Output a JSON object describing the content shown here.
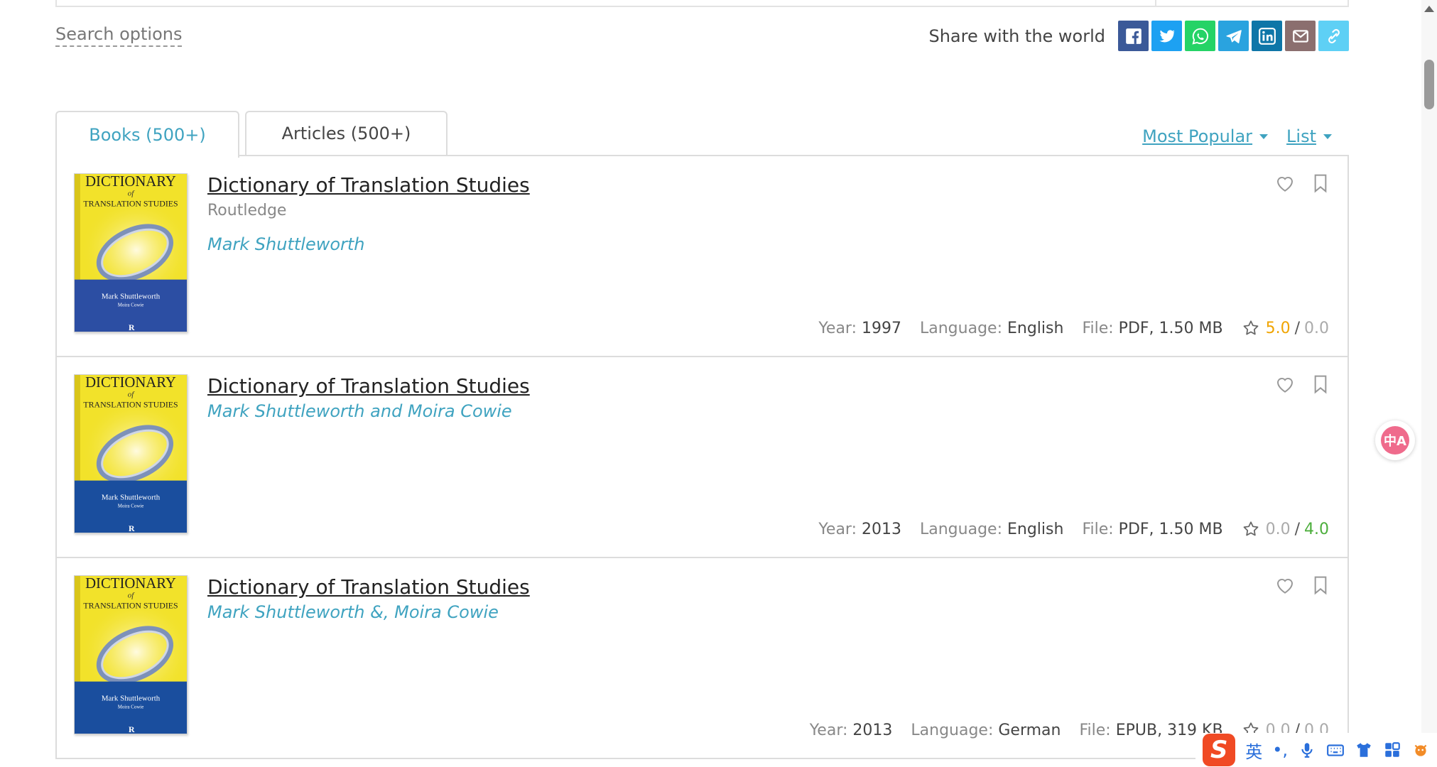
{
  "search_options_label": "Search options",
  "share": {
    "label": "Share with the world",
    "buttons": [
      {
        "name": "facebook",
        "color": "#3b5998"
      },
      {
        "name": "twitter",
        "color": "#1da1f2"
      },
      {
        "name": "whatsapp",
        "color": "#25d366"
      },
      {
        "name": "telegram",
        "color": "#2aa3df"
      },
      {
        "name": "linkedin",
        "color": "#0e76a8"
      },
      {
        "name": "email",
        "color": "#8b6f6f"
      },
      {
        "name": "copy-link",
        "color": "#5ed0f5"
      }
    ]
  },
  "tabs": [
    {
      "label": "Books (500+)",
      "active": true
    },
    {
      "label": "Articles  (500+)",
      "active": false
    }
  ],
  "sort": {
    "order_label": "Most Popular",
    "view_label": "List"
  },
  "books": [
    {
      "title": "Dictionary of Translation Studies",
      "publisher": "Routledge",
      "author": "Mark Shuttleworth",
      "year_label": "Year:",
      "year": "1997",
      "language_label": "Language:",
      "language": "English",
      "file_label": "File:",
      "file": "PDF, 1.50 MB",
      "rating_left": "5.0",
      "rating_sep": "/",
      "rating_right": "0.0",
      "rating_left_color": "gold",
      "rating_right_color": "gray",
      "cover": {
        "title_line1": "DICTIONARY",
        "title_of": "of",
        "title_line2": "TRANSLATION STUDIES",
        "author1": "Mark Shuttleworth",
        "author2": "Moira Cowie",
        "band_color": "#2c4ea3"
      }
    },
    {
      "title": "Dictionary of Translation Studies",
      "publisher": "",
      "author": "Mark Shuttleworth and Moira Cowie",
      "year_label": "Year:",
      "year": "2013",
      "language_label": "Language:",
      "language": "English",
      "file_label": "File:",
      "file": "PDF, 1.50 MB",
      "rating_left": "0.0",
      "rating_sep": "/",
      "rating_right": "4.0",
      "rating_left_color": "gray",
      "rating_right_color": "green",
      "cover": {
        "title_line1": "DICTIONARY",
        "title_of": "of",
        "title_line2": "TRANSLATION STUDIES",
        "author1": "Mark Shuttleworth",
        "author2": "Moira Cowie",
        "band_color": "#1a4e9e"
      }
    },
    {
      "title": "Dictionary of Translation Studies",
      "publisher": "",
      "author": "Mark Shuttleworth &, Moira Cowie",
      "year_label": "Year:",
      "year": "2013",
      "language_label": "Language:",
      "language": "German",
      "file_label": "File:",
      "file": "EPUB, 319 KB",
      "rating_left": "0.0",
      "rating_sep": "/",
      "rating_right": "0.0",
      "rating_left_color": "gray",
      "rating_right_color": "gray",
      "cover": {
        "title_line1": "DICTIONARY",
        "title_of": "of",
        "title_line2": "TRANSLATION STUDIES",
        "author1": "Mark Shuttleworth",
        "author2": "Moira Cowie",
        "band_color": "#1a4e9e"
      }
    }
  ],
  "translate_widget": {
    "glyph": "中A"
  },
  "ime": {
    "logo": "S",
    "mode": "英",
    "punct": "•,"
  },
  "colors": {
    "accent": "#3fa3c0",
    "rating_gold": "#f0a400",
    "rating_green": "#4cae3c"
  }
}
